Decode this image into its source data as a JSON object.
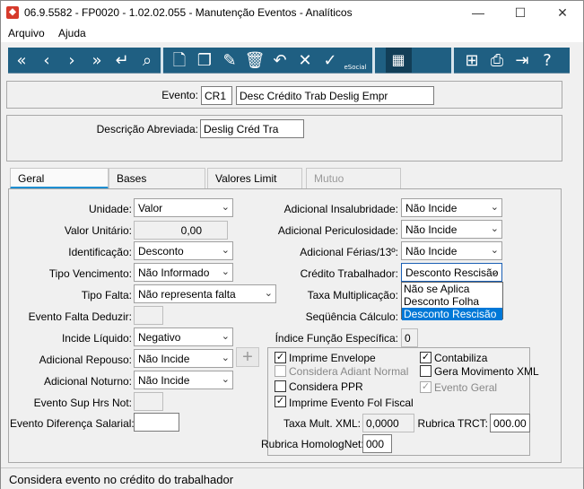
{
  "window": {
    "title": "06.9.5582 - FP0020 - 1.02.02.055 - Manutenção Eventos - Analíticos",
    "minimize": "—",
    "maximize": "☐",
    "close": "✕"
  },
  "menu": {
    "file": "Arquivo",
    "help": "Ajuda"
  },
  "toolbar": {
    "icons": [
      "first-icon",
      "prev-icon",
      "next-icon",
      "last-icon",
      "return-icon",
      "search-icon",
      "new-icon",
      "copy-icon",
      "edit-icon",
      "delete-icon",
      "undo-icon",
      "cancel-icon",
      "confirm-icon",
      "esocial-icon",
      "calendar-icon",
      "tree-icon",
      "print-icon",
      "exit-icon",
      "help-icon"
    ],
    "esocial_label": "eSocial"
  },
  "header": {
    "event_label": "Evento:",
    "event_code": "CR1",
    "event_desc": "Desc Crédito Trab Deslig Empr",
    "short_desc_label": "Descrição Abreviada:",
    "short_desc": "Deslig Créd Tra"
  },
  "tabs": [
    "Geral",
    "Bases",
    "Valores Limit",
    "Mutuo"
  ],
  "left": {
    "unidade_label": "Unidade:",
    "unidade": "Valor",
    "valor_unitario_label": "Valor Unitário:",
    "valor_unitario": "0,00",
    "identificacao_label": "Identificação:",
    "identificacao": "Desconto",
    "tipo_vencimento_label": "Tipo Vencimento:",
    "tipo_vencimento": "Não Informado",
    "tipo_falta_label": "Tipo Falta:",
    "tipo_falta": "Não representa falta",
    "evento_falta_label": "Evento Falta Deduzir:",
    "incide_liquido_label": "Incide Líquido:",
    "incide_liquido": "Negativo",
    "adicional_repouso_label": "Adicional Repouso:",
    "adicional_repouso": "Não Incide",
    "adicional_noturno_label": "Adicional Noturno:",
    "adicional_noturno": "Não Incide",
    "evento_sup_label": "Evento Sup Hrs Not:",
    "evento_dif_label": "Evento Diferença Salarial:"
  },
  "right": {
    "insalubridade_label": "Adicional Insalubridade:",
    "insalubridade": "Não Incide",
    "periculosidade_label": "Adicional Periculosidade:",
    "periculosidade": "Não Incide",
    "ferias_label": "Adicional Férias/13º:",
    "ferias": "Não Incide",
    "credito_label": "Crédito Trabalhador:",
    "credito": "Desconto Rescisão",
    "credito_options": [
      "Não se Aplica",
      "Desconto Folha",
      "Desconto Rescisão"
    ],
    "taxa_mult_label": "Taxa Multiplicação:",
    "sequencia_label": "Seqüência Cálculo:",
    "indice_label": "Índice Função Específica:",
    "indice": "0"
  },
  "options": {
    "imprime_envelope": "Imprime Envelope",
    "contabiliza": "Contabiliza",
    "considera_adiant": "Considera Adiant Normal",
    "gera_movimento": "Gera Movimento XML",
    "considera_ppr": "Considera PPR",
    "evento_geral": "Evento Geral",
    "imprime_fiscal": "Imprime Evento Fol Fiscal",
    "taxa_xml_label": "Taxa Mult. XML:",
    "taxa_xml": "0,0000",
    "rubrica_trct_label": "Rubrica TRCT:",
    "rubrica_trct": "000.00",
    "rubrica_homolog_label": "Rubrica HomologNet:",
    "rubrica_homolog": "000"
  },
  "status": {
    "text": "Considera evento no crédito do trabalhador"
  }
}
